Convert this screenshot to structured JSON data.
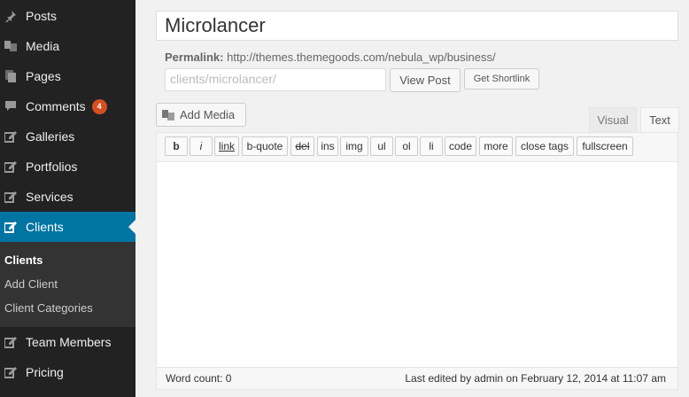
{
  "sidebar": {
    "items": [
      {
        "label": "Posts",
        "icon": "pin-icon"
      },
      {
        "label": "Media",
        "icon": "media-icon"
      },
      {
        "label": "Pages",
        "icon": "pages-icon"
      },
      {
        "label": "Comments",
        "icon": "comment-icon",
        "badge": "4"
      },
      {
        "label": "Galleries",
        "icon": "edit-icon"
      },
      {
        "label": "Portfolios",
        "icon": "edit-icon"
      },
      {
        "label": "Services",
        "icon": "edit-icon"
      },
      {
        "label": "Clients",
        "icon": "edit-icon",
        "active": true
      },
      {
        "label": "Team Members",
        "icon": "edit-icon"
      },
      {
        "label": "Pricing",
        "icon": "edit-icon"
      }
    ],
    "submenu": [
      "Clients",
      "Add Client",
      "Client Categories"
    ]
  },
  "post": {
    "title": "Microlancer",
    "permalink_label": "Permalink:",
    "permalink_url": "http://themes.themegoods.com/nebula_wp/business/",
    "slug_placeholder": "clients/microlancer/",
    "view_post": "View Post",
    "get_shortlink": "Get Shortlink"
  },
  "editor": {
    "add_media": "Add Media",
    "tabs": [
      "Visual",
      "Text"
    ],
    "active_tab": "Text",
    "quicktags": [
      "b",
      "i",
      "link",
      "b-quote",
      "del",
      "ins",
      "img",
      "ul",
      "ol",
      "li",
      "code",
      "more",
      "close tags",
      "fullscreen"
    ],
    "word_count": "Word count: 0",
    "last_edited": "Last edited by admin on February 12, 2014 at 11:07 am"
  },
  "colors": {
    "sidebar_bg": "#222222",
    "active_bg": "#0074a2",
    "badge_bg": "#d54e21"
  }
}
